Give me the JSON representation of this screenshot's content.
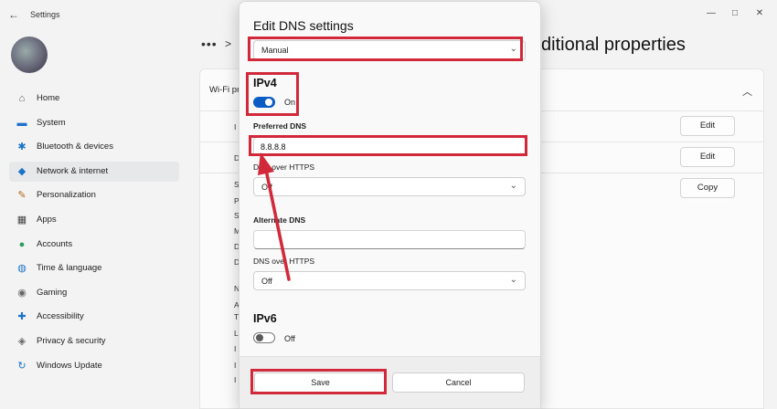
{
  "app": {
    "title": "Settings"
  },
  "window_controls": {
    "minimize": "—",
    "maximize": "□",
    "close": "✕"
  },
  "sidebar": {
    "items": [
      {
        "label": "Home",
        "icon": "home-icon",
        "glyph": "⌂",
        "color": "#555"
      },
      {
        "label": "System",
        "icon": "system-icon",
        "glyph": "▬",
        "color": "#1a73c8"
      },
      {
        "label": "Bluetooth & devices",
        "icon": "bluetooth-icon",
        "glyph": "✱",
        "color": "#1a73c8"
      },
      {
        "label": "Network & internet",
        "icon": "wifi-icon",
        "glyph": "◆",
        "color": "#1a73c8"
      },
      {
        "label": "Personalization",
        "icon": "brush-icon",
        "glyph": "✎",
        "color": "#b5651d"
      },
      {
        "label": "Apps",
        "icon": "apps-icon",
        "glyph": "▦",
        "color": "#444"
      },
      {
        "label": "Accounts",
        "icon": "accounts-icon",
        "glyph": "●",
        "color": "#2a9d5c"
      },
      {
        "label": "Time & language",
        "icon": "globe-icon",
        "glyph": "◍",
        "color": "#1a73c8"
      },
      {
        "label": "Gaming",
        "icon": "gaming-icon",
        "glyph": "◉",
        "color": "#666"
      },
      {
        "label": "Accessibility",
        "icon": "accessibility-icon",
        "glyph": "✚",
        "color": "#1a73c8"
      },
      {
        "label": "Privacy & security",
        "icon": "shield-icon",
        "glyph": "◈",
        "color": "#666"
      },
      {
        "label": "Windows Update",
        "icon": "update-icon",
        "glyph": "↻",
        "color": "#1a73c8"
      }
    ]
  },
  "breadcrumb": {
    "dots": "•••",
    "chevron": ">"
  },
  "page": {
    "title_fragment": "ditional properties"
  },
  "card": {
    "label_fragment": "Wi-Fi pr"
  },
  "side_buttons": {
    "edit_1": "Edit",
    "edit_2": "Edit",
    "copy": "Copy"
  },
  "row_fragments": [
    "I",
    "D",
    "S",
    "P",
    "S",
    "M",
    "D",
    "D",
    "N",
    "A",
    "T",
    "L",
    "I",
    "I",
    "I"
  ],
  "dialog": {
    "title": "Edit DNS settings",
    "mode_select": "Manual",
    "ipv4": {
      "title": "IPv4",
      "toggle_label": "On",
      "preferred_label": "Preferred DNS",
      "preferred_value": "8.8.8.8",
      "doh_label_1": "DNS over HTTPS",
      "doh_value_1": "Off",
      "alternate_label": "Alternate DNS",
      "alternate_value": "",
      "doh_label_2": "DNS over HTTPS",
      "doh_value_2": "Off"
    },
    "ipv6": {
      "title": "IPv6",
      "toggle_label": "Off"
    },
    "save_label": "Save",
    "cancel_label": "Cancel"
  },
  "colors": {
    "highlight": "#d1283a",
    "accent": "#0b5cc4"
  }
}
